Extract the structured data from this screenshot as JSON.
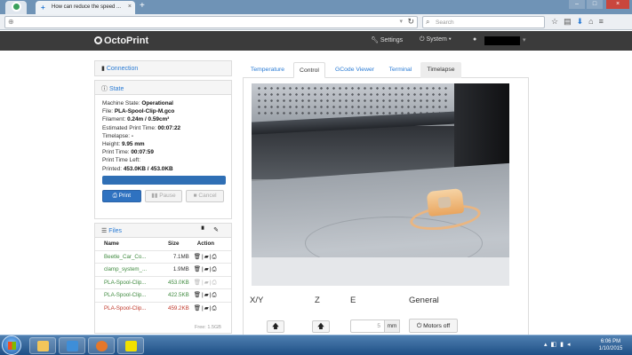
{
  "browser": {
    "tab_title": "How can reduce the speed ...",
    "tab_close": "×",
    "new_tab": "+",
    "url": "",
    "search_placeholder": "Search",
    "window_controls": [
      "–",
      "□",
      "×"
    ]
  },
  "header": {
    "brand": "OctoPrint",
    "settings": "Settings",
    "system": "System",
    "user_redacted": true
  },
  "connection": {
    "label": "Connection"
  },
  "state": {
    "label": "State",
    "machine_state_label": "Machine State:",
    "machine_state": "Operational",
    "file_label": "File:",
    "file": "PLA-Spool-Clip-M.gco",
    "filament_label": "Filament:",
    "filament": "0.24m / 0.59cm³",
    "est_time_label": "Estimated Print Time:",
    "est_time": "00:07:22",
    "timelapse_label": "Timelapse:",
    "timelapse": "-",
    "height_label": "Height:",
    "height": "9.95 mm",
    "print_time_label": "Print Time:",
    "print_time": "00:07:59",
    "time_left_label": "Print Time Left:",
    "time_left": "",
    "printed_label": "Printed:",
    "printed": "453.0KB / 453.0KB",
    "progress": 1.0,
    "buttons": {
      "print": "Print",
      "pause": "Pause",
      "cancel": "Cancel"
    }
  },
  "files": {
    "label": "Files",
    "columns": [
      "Name",
      "Size",
      "Action"
    ],
    "rows": [
      {
        "name": "Beetle_Car_Co...",
        "size": "7.1MB",
        "status": "ok"
      },
      {
        "name": "clamp_system_...",
        "size": "1.9MB",
        "status": "ok"
      },
      {
        "name": "PLA-Spool-Clip...",
        "size": "453.0KB",
        "status": "ok"
      },
      {
        "name": "PLA-Spool-Clip...",
        "size": "422.5KB",
        "status": "ok"
      },
      {
        "name": "PLA-Spool-Clip...",
        "size": "459.2KB",
        "status": "error"
      }
    ],
    "free": "Free: 1.5GB"
  },
  "tabs": [
    "Temperature",
    "Control",
    "GCode Viewer",
    "Terminal",
    "Timelapse"
  ],
  "active_tab": "Control",
  "control": {
    "xy": "X/Y",
    "z": "Z",
    "e": "E",
    "general": "General",
    "extrude_amount": "5",
    "unit": "mm",
    "motors_off": "Motors off"
  },
  "taskbar": {
    "time": "6:06 PM",
    "date": "1/10/2015"
  }
}
